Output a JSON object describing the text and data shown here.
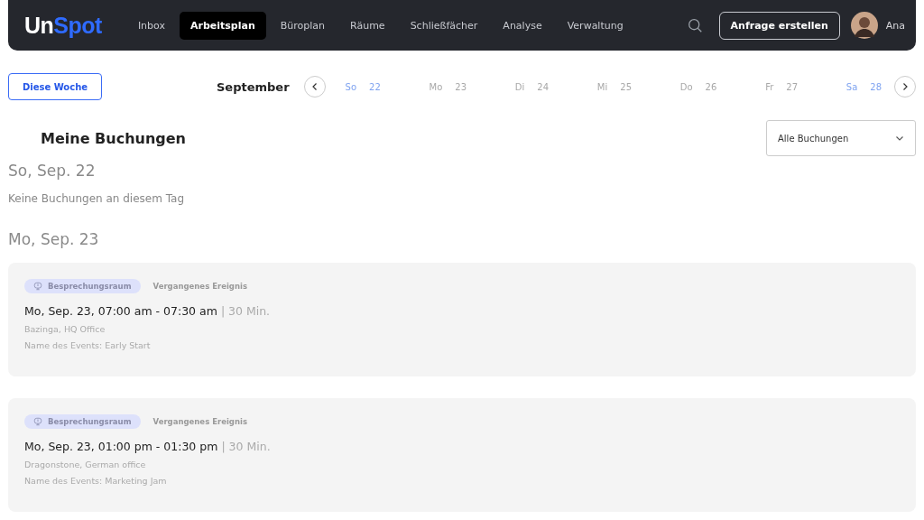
{
  "nav": {
    "logo_a": "Un",
    "logo_b": "Spot",
    "items": [
      {
        "label": "Inbox",
        "selected": false
      },
      {
        "label": "Arbeitsplan",
        "selected": true
      },
      {
        "label": "Büroplan",
        "selected": false
      },
      {
        "label": "Räume",
        "selected": false
      },
      {
        "label": "Schließfächer",
        "selected": false
      },
      {
        "label": "Analyse",
        "selected": false
      },
      {
        "label": "Verwaltung",
        "selected": false
      }
    ],
    "request_button": "Anfrage erstellen",
    "user": "Ana"
  },
  "week": {
    "this_week_button": "Diese Woche",
    "month": "September",
    "days": [
      {
        "day": "So",
        "date": "22",
        "weekend": true
      },
      {
        "day": "Mo",
        "date": "23",
        "weekend": false
      },
      {
        "day": "Di",
        "date": "24",
        "weekend": false
      },
      {
        "day": "Mi",
        "date": "25",
        "weekend": false
      },
      {
        "day": "Do",
        "date": "26",
        "weekend": false
      },
      {
        "day": "Fr",
        "date": "27",
        "weekend": false
      },
      {
        "day": "Sa",
        "date": "28",
        "weekend": true
      }
    ]
  },
  "title": "Meine Buchungen",
  "filter": "Alle Buchungen",
  "sections": [
    {
      "heading": "So, Sep. 22",
      "empty_text": "Keine Buchungen an diesem Tag"
    },
    {
      "heading": "Mo, Sep. 23",
      "bookings": [
        {
          "tag": "Besprechungsraum",
          "status": "Vergangenes Ereignis",
          "time": "Mo, Sep. 23, 07:00 am - 07:30 am",
          "duration": "| 30 Min.",
          "place": "Bazinga, HQ Office",
          "event": "Name des Events: Early Start"
        },
        {
          "tag": "Besprechungsraum",
          "status": "Vergangenes Ereignis",
          "time": "Mo, Sep. 23, 01:00 pm - 01:30 pm",
          "duration": "| 30 Min.",
          "place": "Dragonstone, German office",
          "event": "Name des Events: Marketing Jam"
        }
      ]
    }
  ]
}
